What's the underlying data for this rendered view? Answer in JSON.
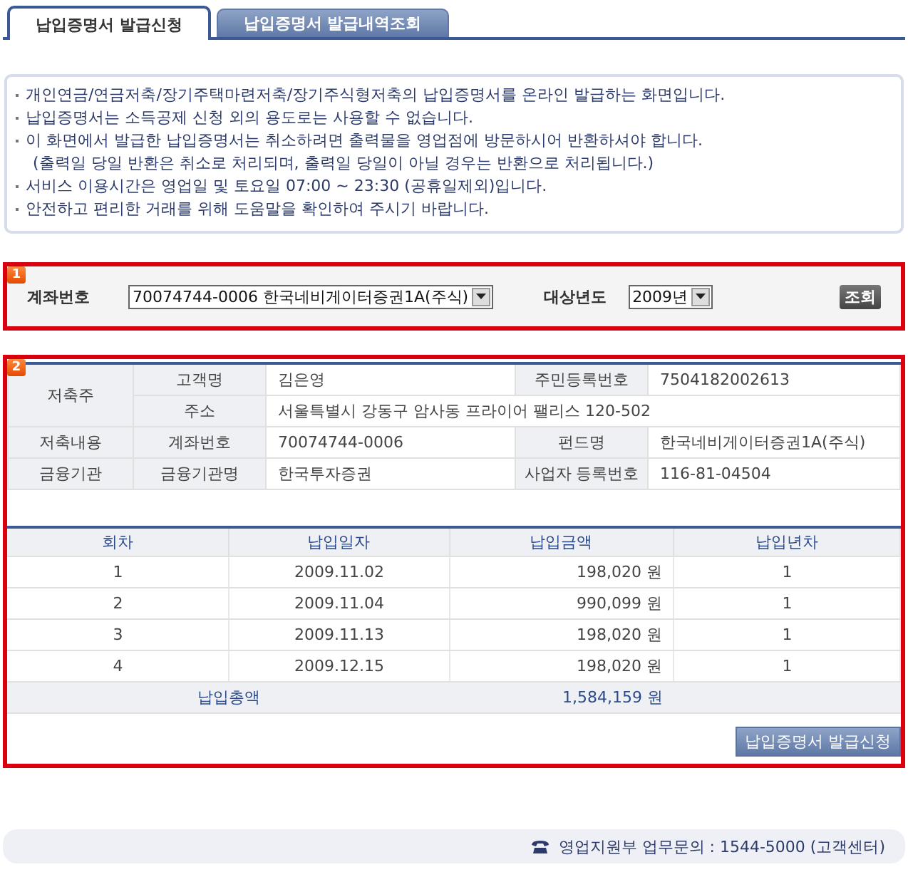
{
  "tabs": [
    {
      "label": "납입증명서 발급신청",
      "selected": true
    },
    {
      "label": "납입증명서 발급내역조회",
      "selected": false
    }
  ],
  "notices": [
    {
      "kind": "bullet",
      "text": "개인연금/연금저축/장기주택마련저축/장기주식형저축의 납입증명서를 온라인 발급하는 화면입니다."
    },
    {
      "kind": "bullet",
      "text": "납입증명서는 소득공제 신청 외의 용도로는 사용할 수 없습니다."
    },
    {
      "kind": "bullet",
      "text": "이 화면에서 발급한 납입증명서는 취소하려면 출력물을 영업점에 방문하시어 반환하셔야 합니다."
    },
    {
      "kind": "continuation",
      "text": "(출력일 당일 반환은 취소로 처리되며, 출력일 당일이 아닐 경우는 반환으로 처리됩니다.)"
    },
    {
      "kind": "bullet",
      "text": "서비스 이용시간은 영업일 및 토요일 07:00 ~ 23:30 (공휴일제외)입니다."
    },
    {
      "kind": "bullet",
      "text": "안전하고 편리한 거래를 위해 도움말을 확인하여 주시기 바랍니다."
    }
  ],
  "search": {
    "badge": "1",
    "account_label": "계좌번호",
    "account_value": "70074744-0006 한국네비게이터증권1A(주식)",
    "year_label": "대상년도",
    "year_value": "2009년",
    "button": "조회"
  },
  "holder": {
    "badge": "2",
    "groups": [
      {
        "header": "저축주",
        "rows": [
          {
            "fields": [
              {
                "label": "고객명",
                "value": "김은영"
              },
              {
                "label": "주민등록번호",
                "value": "7504182002613"
              }
            ]
          },
          {
            "fields": [
              {
                "label": "주소",
                "value": "서울특별시 강동구 암사동 프라이어 팰리스 120-502"
              }
            ]
          }
        ]
      },
      {
        "header": "저축내용",
        "rows": [
          {
            "fields": [
              {
                "label": "계좌번호",
                "value": "70074744-0006"
              },
              {
                "label": "펀드명",
                "value": "한국네비게이터증권1A(주식)"
              }
            ]
          }
        ]
      },
      {
        "header": "금융기관",
        "rows": [
          {
            "fields": [
              {
                "label": "금융기관명",
                "value": "한국투자증권"
              },
              {
                "label": "사업자 등록번호",
                "value": "116-81-04504"
              }
            ]
          }
        ]
      }
    ],
    "payments": {
      "columns": [
        "회차",
        "납입일자",
        "납입금액",
        "납입년차"
      ],
      "rows": [
        [
          "1",
          "2009.11.02",
          "198,020 원",
          "1"
        ],
        [
          "2",
          "2009.11.04",
          "990,099 원",
          "1"
        ],
        [
          "3",
          "2009.11.13",
          "198,020 원",
          "1"
        ],
        [
          "4",
          "2009.12.15",
          "198,020 원",
          "1"
        ]
      ],
      "total_label": "납입총액",
      "total_amount": "1,584,159 원"
    },
    "apply_button": "납입증명서 발급신청"
  },
  "footer": {
    "text": "영업지원부 업무문의 : 1544-5000 (고객센터)"
  }
}
